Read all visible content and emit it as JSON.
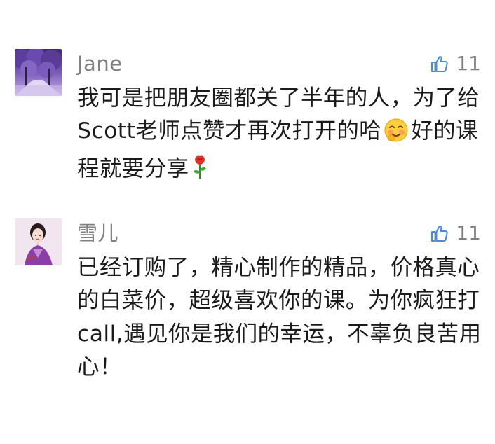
{
  "comments": [
    {
      "user": "Jane",
      "likes": "11",
      "text_parts": [
        "我可是把朋友圈都关了半年的人，为了给Scott老师点赞才再次打开的哈",
        "好的课程就要分享"
      ],
      "emojis": [
        "blush-emoji",
        "rose-emoji"
      ]
    },
    {
      "user": "雪儿",
      "likes": "11",
      "text": "已经订购了，精心制作的精品，价格真心的白菜价，超级喜欢你的课。为你疯狂打call,遇见你是我们的幸运，不辜负良苦用心！"
    }
  ],
  "icons": {
    "like": "thumbs-up-icon"
  },
  "colors": {
    "like_icon": "#4a8bd9",
    "meta_text": "#808080",
    "body_text": "#1a1a1a"
  }
}
